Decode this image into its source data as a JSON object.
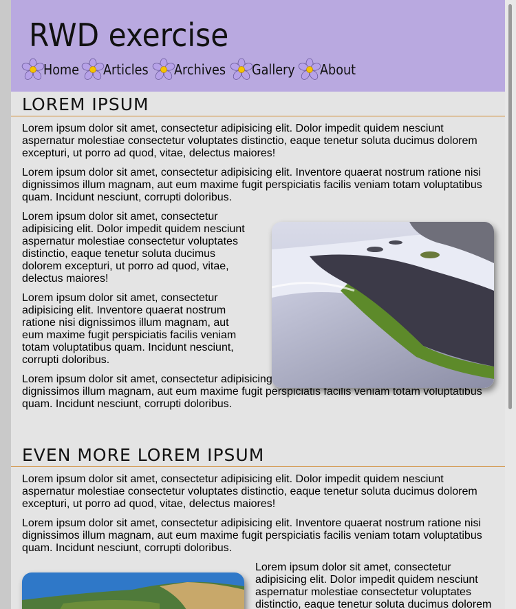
{
  "site": {
    "title": "RWD exercise"
  },
  "nav": [
    {
      "label": "Home"
    },
    {
      "label": "Articles"
    },
    {
      "label": "Archives"
    },
    {
      "label": "Gallery"
    },
    {
      "label": "About"
    }
  ],
  "section1": {
    "heading": "LOREM IPSUM",
    "p1": "Lorem ipsum dolor sit amet, consectetur adipisicing elit. Dolor impedit quidem nesciunt aspernatur molestiae consectetur voluptates distinctio, eaque tenetur soluta ducimus dolorem excepturi, ut porro ad quod, vitae, delectus maiores!",
    "p2": "Lorem ipsum dolor sit amet, consectetur adipisicing elit. Inventore quaerat nostrum ratione nisi dignissimos illum magnam, aut eum maxime fugit perspiciatis facilis veniam totam voluptatibus quam. Incidunt nesciunt, corrupti doloribus.",
    "p3": "Lorem ipsum dolor sit amet, consectetur adipisicing elit. Dolor impedit quidem nesciunt aspernatur molestiae consectetur voluptates distinctio, eaque tenetur soluta ducimus dolorem excepturi, ut porro ad quod, vitae, delectus maiores!",
    "p4": "Lorem ipsum dolor sit amet, consectetur adipisicing elit. Inventore quaerat nostrum ratione nisi dignissimos illum magnam, aut eum maxime fugit perspiciatis facilis veniam totam voluptatibus quam. Incidunt nesciunt, corrupti doloribus.",
    "p5": "Lorem ipsum dolor sit amet, consectetur adipisicing elit. Inventore quaerat nostrum ratione nisi dignissimos illum magnam, aut eum maxime fugit perspiciatis facilis veniam totam voluptatibus quam. Incidunt nesciunt, corrupti doloribus."
  },
  "section2": {
    "heading": "EVEN MORE LOREM IPSUM",
    "p1": "Lorem ipsum dolor sit amet, consectetur adipisicing elit. Dolor impedit quidem nesciunt aspernatur molestiae consectetur voluptates distinctio, eaque tenetur soluta ducimus dolorem excepturi, ut porro ad quod, vitae, delectus maiores!",
    "p2": "Lorem ipsum dolor sit amet, consectetur adipisicing elit. Inventore quaerat nostrum ratione nisi dignissimos illum magnam, aut eum maxime fugit perspiciatis facilis veniam totam voluptatibus quam. Incidunt nesciunt, corrupti doloribus.",
    "p3": "Lorem ipsum dolor sit amet, consectetur adipisicing elit. Dolor impedit quidem nesciunt aspernatur molestiae consectetur voluptates distinctio, eaque tenetur soluta ducimus dolorem"
  },
  "colors": {
    "header": "#b9a9e0",
    "rule": "#d08a30",
    "page": "#e4e4e4"
  },
  "icons": {
    "nav": "flower-icon"
  }
}
